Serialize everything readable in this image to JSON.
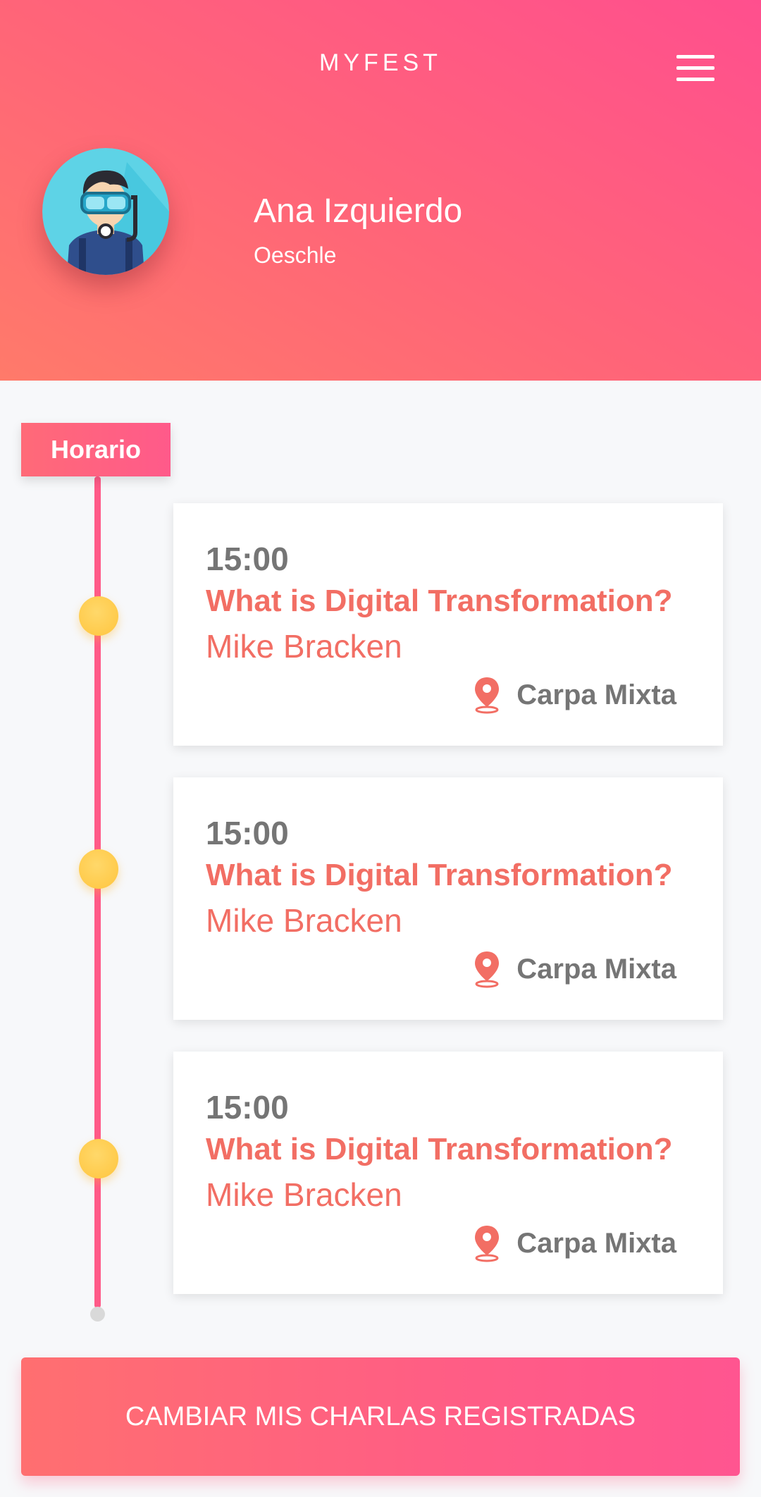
{
  "header": {
    "title": "MYFEST",
    "menu_icon": "hamburger-menu-icon",
    "user": {
      "name": "Ana Izquierdo",
      "subtitle": "Oeschle",
      "avatar_icon": "diver-avatar"
    }
  },
  "schedule": {
    "section_label": "Horario",
    "items": [
      {
        "time": "15:00",
        "title": "What is Digital Transformation?",
        "speaker": "Mike Bracken",
        "location": "Carpa Mixta"
      },
      {
        "time": "15:00",
        "title": "What is Digital Transformation?",
        "speaker": "Mike Bracken",
        "location": "Carpa Mixta"
      },
      {
        "time": "15:00",
        "title": "What is Digital Transformation?",
        "speaker": "Mike Bracken",
        "location": "Carpa Mixta"
      }
    ]
  },
  "cta": {
    "label": "CAMBIAR MIS CHARLAS REGISTRADAS"
  },
  "colors": {
    "accent_pink": "#ff5a88",
    "accent_coral": "#f26e64",
    "dot_yellow": "#ffc53e",
    "text_gray": "#757575"
  }
}
